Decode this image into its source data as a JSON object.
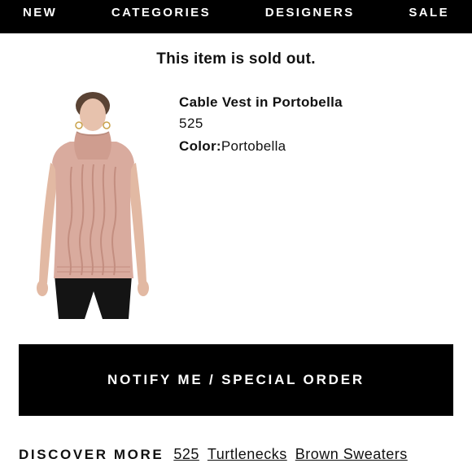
{
  "nav": {
    "items": [
      {
        "label": "NEW"
      },
      {
        "label": "CATEGORIES"
      },
      {
        "label": "DESIGNERS"
      },
      {
        "label": "SALE"
      }
    ]
  },
  "notice": "This item is sold out.",
  "product": {
    "name": "Cable Vest in Portobella",
    "brand": "525",
    "color_label": "Color:",
    "color_value": "Portobella"
  },
  "notify_button": "NOTIFY ME / SPECIAL ORDER",
  "discover": {
    "heading": "DISCOVER MORE",
    "links": [
      "525",
      "Turtlenecks",
      "Brown Sweaters"
    ]
  },
  "colors": {
    "nav_bg": "#000000",
    "sweater": "#d9ab9e"
  }
}
